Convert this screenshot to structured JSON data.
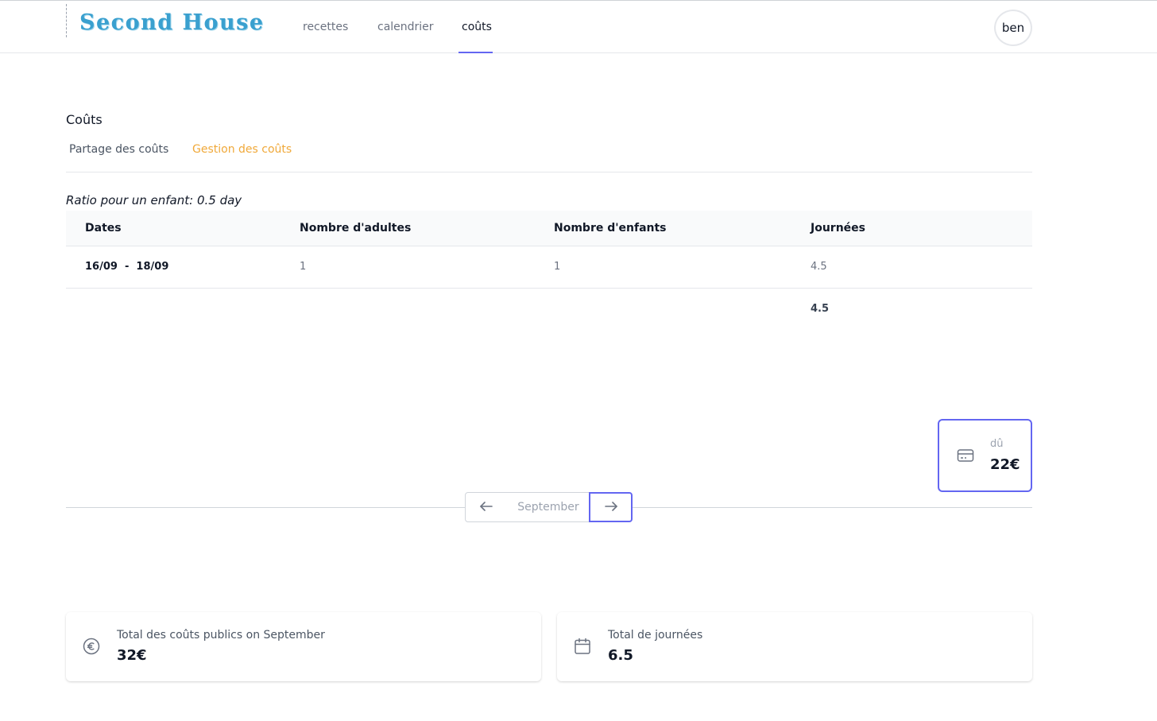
{
  "header": {
    "logo": "Second House",
    "nav": [
      {
        "label": "recettes"
      },
      {
        "label": "calendrier"
      },
      {
        "label": "coûts"
      }
    ],
    "user": "ben",
    "accent": "#6366f1"
  },
  "main": {
    "title": "Coûts",
    "tabs": [
      {
        "label": "Partage des coûts"
      },
      {
        "label": "Gestion des coûts",
        "active": true,
        "color": "#f0a93a"
      }
    ],
    "ratio_text": "Ratio pour un enfant: 0.5 day",
    "table": {
      "headers": [
        "Dates",
        "Nombre d'adultes",
        "Nombre d'enfants",
        "Journées"
      ],
      "rows": [
        {
          "dates": "16/09  -  18/09",
          "adults": "1",
          "children": "1",
          "days": "4.5"
        }
      ],
      "total_days": "4.5"
    },
    "due": {
      "icon": "credit-card-icon",
      "label": "dû",
      "value": "22€"
    },
    "pager": {
      "month": "September",
      "prev_icon": "arrow-left-icon",
      "next_icon": "arrow-right-icon"
    }
  },
  "stats": [
    {
      "icon": "euro-icon",
      "label": "Total des coûts publics on September",
      "value": "32€"
    },
    {
      "icon": "calendar-icon",
      "label": "Total de journées",
      "value": "6.5"
    }
  ]
}
